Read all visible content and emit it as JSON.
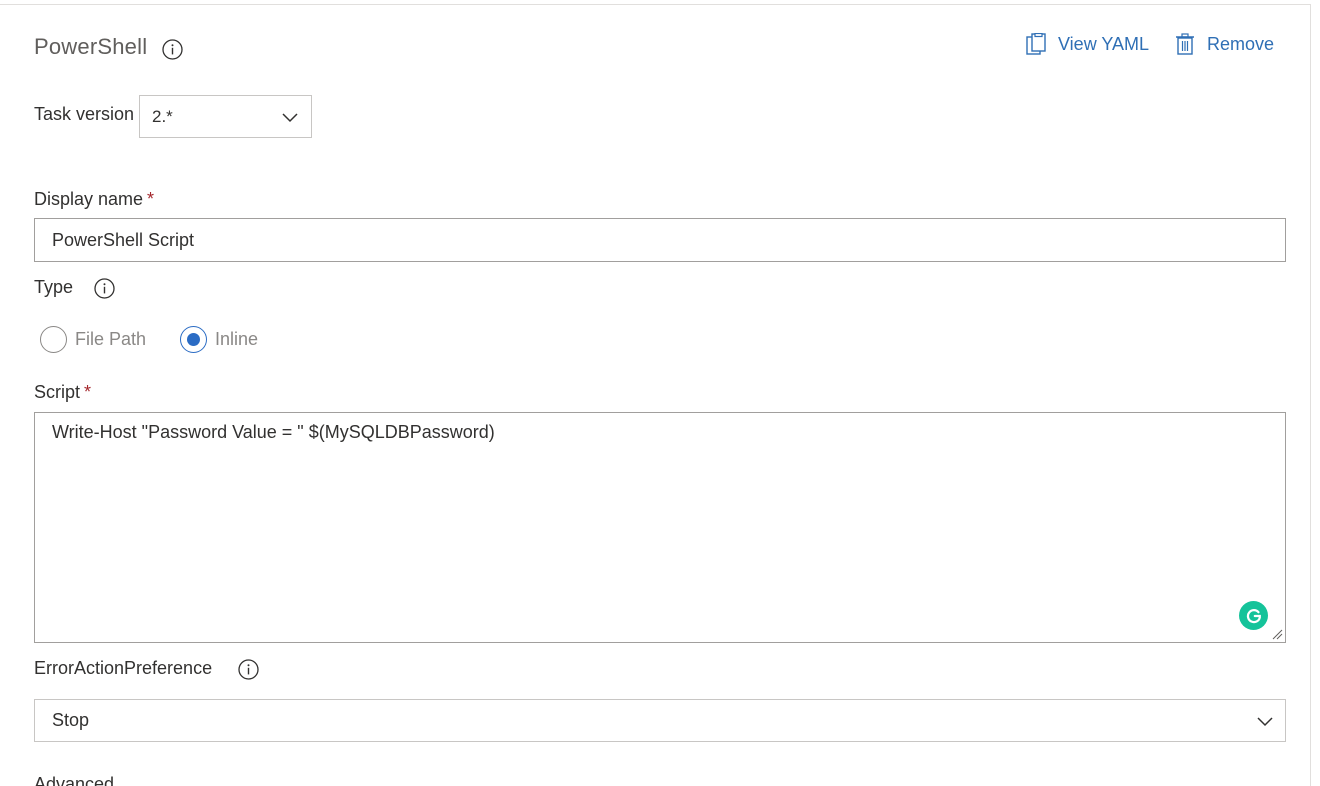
{
  "task": {
    "title": "PowerShell",
    "view_yaml_label": "View YAML",
    "remove_label": "Remove"
  },
  "task_version": {
    "label": "Task version",
    "value": "2.*"
  },
  "display_name": {
    "label": "Display name",
    "required_mark": "*",
    "value": "PowerShell Script"
  },
  "type": {
    "label": "Type",
    "options": [
      {
        "label": "File Path",
        "selected": false
      },
      {
        "label": "Inline",
        "selected": true
      }
    ]
  },
  "script": {
    "label": "Script",
    "required_mark": "*",
    "value": "Write-Host \"Password Value = \" $(MySQLDBPassword)"
  },
  "error_action_preference": {
    "label": "ErrorActionPreference",
    "value": "Stop"
  },
  "advanced": {
    "label": "Advanced"
  },
  "colors": {
    "accent": "#2b6cc4",
    "link": "#2f6fb5",
    "required": "#a4262c",
    "grammarly": "#15c39a"
  }
}
